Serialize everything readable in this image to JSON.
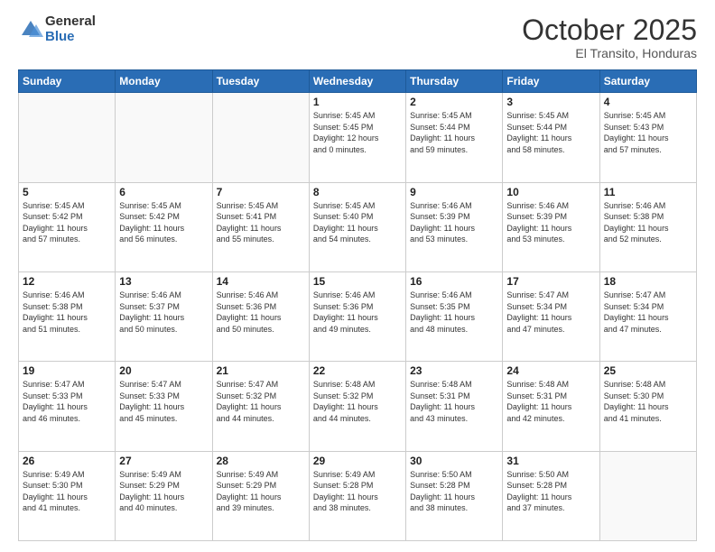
{
  "logo": {
    "general": "General",
    "blue": "Blue"
  },
  "header": {
    "month": "October 2025",
    "location": "El Transito, Honduras"
  },
  "days_of_week": [
    "Sunday",
    "Monday",
    "Tuesday",
    "Wednesday",
    "Thursday",
    "Friday",
    "Saturday"
  ],
  "weeks": [
    [
      {
        "day": "",
        "info": ""
      },
      {
        "day": "",
        "info": ""
      },
      {
        "day": "",
        "info": ""
      },
      {
        "day": "1",
        "info": "Sunrise: 5:45 AM\nSunset: 5:45 PM\nDaylight: 12 hours\nand 0 minutes."
      },
      {
        "day": "2",
        "info": "Sunrise: 5:45 AM\nSunset: 5:44 PM\nDaylight: 11 hours\nand 59 minutes."
      },
      {
        "day": "3",
        "info": "Sunrise: 5:45 AM\nSunset: 5:44 PM\nDaylight: 11 hours\nand 58 minutes."
      },
      {
        "day": "4",
        "info": "Sunrise: 5:45 AM\nSunset: 5:43 PM\nDaylight: 11 hours\nand 57 minutes."
      }
    ],
    [
      {
        "day": "5",
        "info": "Sunrise: 5:45 AM\nSunset: 5:42 PM\nDaylight: 11 hours\nand 57 minutes."
      },
      {
        "day": "6",
        "info": "Sunrise: 5:45 AM\nSunset: 5:42 PM\nDaylight: 11 hours\nand 56 minutes."
      },
      {
        "day": "7",
        "info": "Sunrise: 5:45 AM\nSunset: 5:41 PM\nDaylight: 11 hours\nand 55 minutes."
      },
      {
        "day": "8",
        "info": "Sunrise: 5:45 AM\nSunset: 5:40 PM\nDaylight: 11 hours\nand 54 minutes."
      },
      {
        "day": "9",
        "info": "Sunrise: 5:46 AM\nSunset: 5:39 PM\nDaylight: 11 hours\nand 53 minutes."
      },
      {
        "day": "10",
        "info": "Sunrise: 5:46 AM\nSunset: 5:39 PM\nDaylight: 11 hours\nand 53 minutes."
      },
      {
        "day": "11",
        "info": "Sunrise: 5:46 AM\nSunset: 5:38 PM\nDaylight: 11 hours\nand 52 minutes."
      }
    ],
    [
      {
        "day": "12",
        "info": "Sunrise: 5:46 AM\nSunset: 5:38 PM\nDaylight: 11 hours\nand 51 minutes."
      },
      {
        "day": "13",
        "info": "Sunrise: 5:46 AM\nSunset: 5:37 PM\nDaylight: 11 hours\nand 50 minutes."
      },
      {
        "day": "14",
        "info": "Sunrise: 5:46 AM\nSunset: 5:36 PM\nDaylight: 11 hours\nand 50 minutes."
      },
      {
        "day": "15",
        "info": "Sunrise: 5:46 AM\nSunset: 5:36 PM\nDaylight: 11 hours\nand 49 minutes."
      },
      {
        "day": "16",
        "info": "Sunrise: 5:46 AM\nSunset: 5:35 PM\nDaylight: 11 hours\nand 48 minutes."
      },
      {
        "day": "17",
        "info": "Sunrise: 5:47 AM\nSunset: 5:34 PM\nDaylight: 11 hours\nand 47 minutes."
      },
      {
        "day": "18",
        "info": "Sunrise: 5:47 AM\nSunset: 5:34 PM\nDaylight: 11 hours\nand 47 minutes."
      }
    ],
    [
      {
        "day": "19",
        "info": "Sunrise: 5:47 AM\nSunset: 5:33 PM\nDaylight: 11 hours\nand 46 minutes."
      },
      {
        "day": "20",
        "info": "Sunrise: 5:47 AM\nSunset: 5:33 PM\nDaylight: 11 hours\nand 45 minutes."
      },
      {
        "day": "21",
        "info": "Sunrise: 5:47 AM\nSunset: 5:32 PM\nDaylight: 11 hours\nand 44 minutes."
      },
      {
        "day": "22",
        "info": "Sunrise: 5:48 AM\nSunset: 5:32 PM\nDaylight: 11 hours\nand 44 minutes."
      },
      {
        "day": "23",
        "info": "Sunrise: 5:48 AM\nSunset: 5:31 PM\nDaylight: 11 hours\nand 43 minutes."
      },
      {
        "day": "24",
        "info": "Sunrise: 5:48 AM\nSunset: 5:31 PM\nDaylight: 11 hours\nand 42 minutes."
      },
      {
        "day": "25",
        "info": "Sunrise: 5:48 AM\nSunset: 5:30 PM\nDaylight: 11 hours\nand 41 minutes."
      }
    ],
    [
      {
        "day": "26",
        "info": "Sunrise: 5:49 AM\nSunset: 5:30 PM\nDaylight: 11 hours\nand 41 minutes."
      },
      {
        "day": "27",
        "info": "Sunrise: 5:49 AM\nSunset: 5:29 PM\nDaylight: 11 hours\nand 40 minutes."
      },
      {
        "day": "28",
        "info": "Sunrise: 5:49 AM\nSunset: 5:29 PM\nDaylight: 11 hours\nand 39 minutes."
      },
      {
        "day": "29",
        "info": "Sunrise: 5:49 AM\nSunset: 5:28 PM\nDaylight: 11 hours\nand 38 minutes."
      },
      {
        "day": "30",
        "info": "Sunrise: 5:50 AM\nSunset: 5:28 PM\nDaylight: 11 hours\nand 38 minutes."
      },
      {
        "day": "31",
        "info": "Sunrise: 5:50 AM\nSunset: 5:28 PM\nDaylight: 11 hours\nand 37 minutes."
      },
      {
        "day": "",
        "info": ""
      }
    ]
  ]
}
